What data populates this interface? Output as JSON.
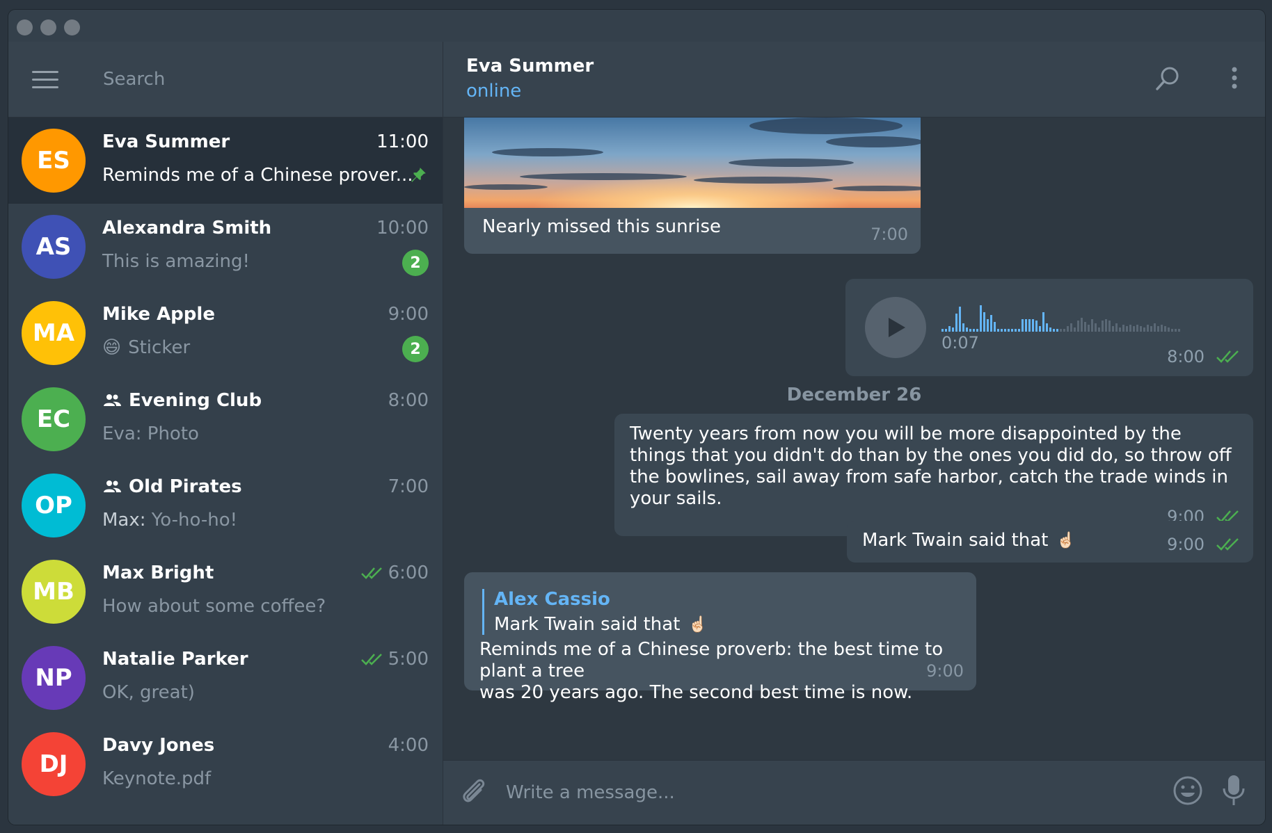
{
  "window": {
    "title": ""
  },
  "sidebar": {
    "search_placeholder": "Search",
    "chats": [
      {
        "initials": "ES",
        "color": "#ff9800",
        "name": "Eva Summer",
        "time": "11:00",
        "preview": "Reminds me of a Chinese prover...",
        "pinned": true,
        "active": true
      },
      {
        "initials": "AS",
        "color": "#3f51b5",
        "name": "Alexandra Smith",
        "time": "10:00",
        "preview": "This is amazing!",
        "badge": "2"
      },
      {
        "initials": "MA",
        "color": "#ffc107",
        "name": "Mike Apple",
        "time": "9:00",
        "preview": "Sticker",
        "emoji": "😄",
        "badge": "2"
      },
      {
        "initials": "EC",
        "color": "#4caf50",
        "name": "Evening Club",
        "time": "8:00",
        "preview": "Eva: Photo",
        "group": true
      },
      {
        "initials": "OP",
        "color": "#00bcd4",
        "name": "Old Pirates",
        "time": "7:00",
        "sender": "Max:",
        "preview": "Yo-ho-ho!",
        "group": true
      },
      {
        "initials": "MB",
        "color": "#cddc39",
        "name": "Max Bright",
        "time": "6:00",
        "preview": "How about some coffee?",
        "read": true
      },
      {
        "initials": "NP",
        "color": "#673ab7",
        "name": "Natalie Parker",
        "time": "5:00",
        "preview": "OK, great)",
        "read": true
      },
      {
        "initials": "DJ",
        "color": "#f44336",
        "name": "Davy Jones",
        "time": "4:00",
        "preview": "Keynote.pdf"
      }
    ]
  },
  "conversation": {
    "name": "Eva Summer",
    "status": "online",
    "date_separator": "December 26",
    "photo_message": {
      "caption": "Nearly missed this sunrise",
      "time": "7:00"
    },
    "voice_message": {
      "duration": "0:07",
      "time": "8:00"
    },
    "quote_message": {
      "lines": [
        "Twenty years from now you will be more disappointed by the",
        "things that you didn't do than by the ones you did do, so throw off",
        "the bowlines, sail away from safe harbor, catch the trade winds in",
        "your sails."
      ],
      "time": "9:00"
    },
    "short_message": {
      "text": "Mark Twain said that",
      "emoji": "☝🏻",
      "time": "9:00"
    },
    "reply_message": {
      "reply_author": "Alex Cassio",
      "reply_text": "Mark Twain said that",
      "reply_emoji": "☝🏻",
      "lines": [
        "Reminds me of a Chinese proverb: the best time to plant a tree",
        "was 20 years ago. The second best time is now."
      ],
      "time": "9:00"
    },
    "composer_placeholder": "Write a message..."
  },
  "colors": {
    "accent": "#64b5f6",
    "read_ticks": "#4caf50",
    "badge": "#4caf50"
  }
}
